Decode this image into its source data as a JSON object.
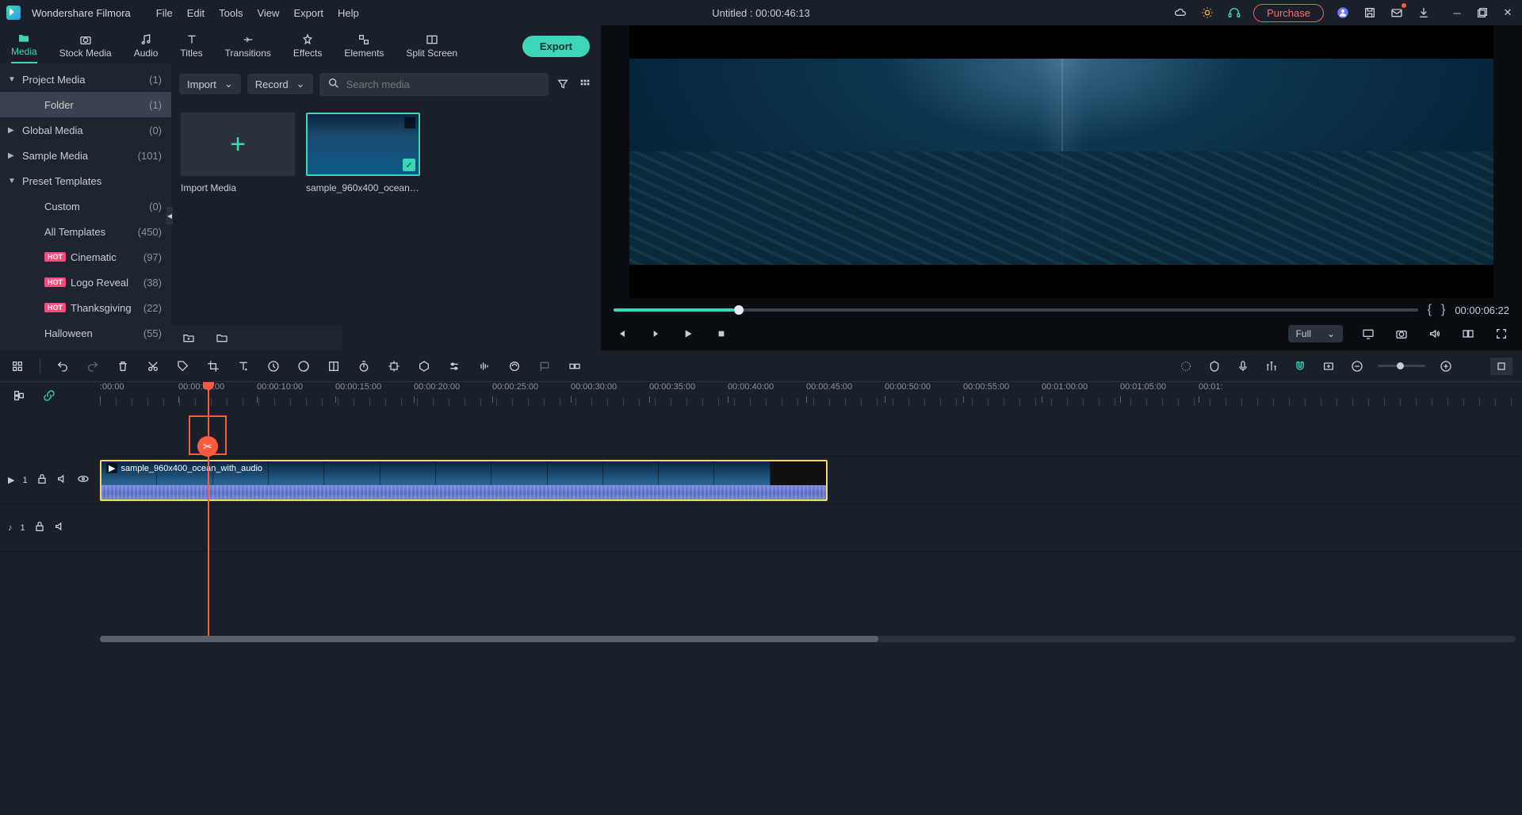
{
  "app": {
    "name": "Wondershare Filmora",
    "title": "Untitled : 00:00:46:13"
  },
  "menu": [
    "File",
    "Edit",
    "Tools",
    "View",
    "Export",
    "Help"
  ],
  "purchase": "Purchase",
  "tabs": [
    {
      "label": "Media",
      "active": true
    },
    {
      "label": "Stock Media"
    },
    {
      "label": "Audio"
    },
    {
      "label": "Titles"
    },
    {
      "label": "Transitions"
    },
    {
      "label": "Effects"
    },
    {
      "label": "Elements"
    },
    {
      "label": "Split Screen"
    }
  ],
  "export": "Export",
  "sidebar": [
    {
      "label": "Project Media",
      "count": "(1)",
      "tri": "▼"
    },
    {
      "label": "Folder",
      "count": "(1)",
      "child": true,
      "sel": true
    },
    {
      "label": "Global Media",
      "count": "(0)",
      "tri": "▶"
    },
    {
      "label": "Sample Media",
      "count": "(101)",
      "tri": "▶"
    },
    {
      "label": "Preset Templates",
      "count": "",
      "tri": "▼"
    },
    {
      "label": "Custom",
      "count": "(0)",
      "child": true
    },
    {
      "label": "All Templates",
      "count": "(450)",
      "child": true
    },
    {
      "label": "Cinematic",
      "count": "(97)",
      "child": true,
      "hot": true
    },
    {
      "label": "Logo Reveal",
      "count": "(38)",
      "child": true,
      "hot": true
    },
    {
      "label": "Thanksgiving",
      "count": "(22)",
      "child": true,
      "hot": true
    },
    {
      "label": "Halloween",
      "count": "(55)",
      "child": true
    }
  ],
  "hot": "HOT",
  "importBtn": "Import",
  "recordBtn": "Record",
  "searchPlaceholder": "Search media",
  "importTile": "Import Media",
  "clipName": "sample_960x400_ocean_...",
  "preview": {
    "time": "00:00:06:22",
    "quality": "Full"
  },
  "ruler": [
    ":00:00",
    "00:00:05:00",
    "00:00:10:00",
    "00:00:15:00",
    "00:00:20:00",
    "00:00:25:00",
    "00:00:30:00",
    "00:00:35:00",
    "00:00:40:00",
    "00:00:45:00",
    "00:00:50:00",
    "00:00:55:00",
    "00:01:00:00",
    "00:01:05:00",
    "00:01:"
  ],
  "trackClip": "sample_960x400_ocean_with_audio",
  "trackNum": "1"
}
